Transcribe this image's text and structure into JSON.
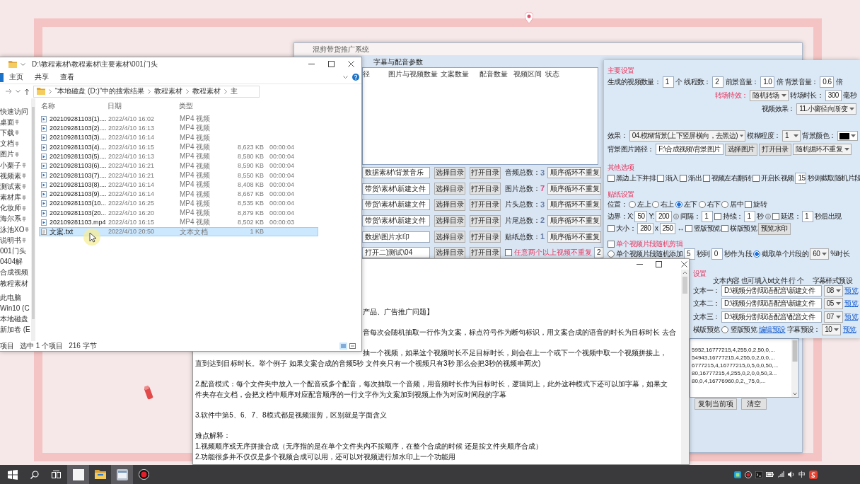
{
  "explorer": {
    "title": "D:\\教程素材\\教程素材\\主要素材\\001门头",
    "ribbon_tabs": [
      {
        "label": "主页",
        "selected": false
      },
      {
        "label": "共享",
        "selected": false
      },
      {
        "label": "查看",
        "selected": false
      }
    ],
    "breadcrumbs": [
      "“本地磁盘 (D:)”中的搜索结果",
      "教程素材",
      "教程素材",
      "主"
    ],
    "nav_groups": [
      {
        "label": "快速访问",
        "items": [
          {
            "label": "桌面",
            "pinned": true
          },
          {
            "label": "下载",
            "pinned": true
          },
          {
            "label": "文档",
            "pinned": true
          },
          {
            "label": "图片",
            "pinned": true
          },
          {
            "label": "小栗子",
            "pinned": true
          },
          {
            "label": "视频素",
            "pinned": true
          },
          {
            "label": "测试素",
            "pinned": true
          },
          {
            "label": "素材库",
            "pinned": true
          },
          {
            "label": "化妆师",
            "pinned": true
          },
          {
            "label": "海尔系",
            "pinned": true
          },
          {
            "label": "泳池XO",
            "pinned": true
          },
          {
            "label": "说明书",
            "pinned": true
          },
          {
            "label": "001门头",
            "pinned": false
          },
          {
            "label": "0404解",
            "pinned": false
          },
          {
            "label": "合成视频",
            "pinned": false
          },
          {
            "label": "教程素材",
            "pinned": false
          }
        ]
      },
      {
        "label": "此电脑",
        "items": [
          {
            "label": "Win10 (C",
            "pinned": false
          },
          {
            "label": "本地磁盘",
            "pinned": false
          },
          {
            "label": "新加卷 (E",
            "pinned": false
          }
        ]
      }
    ],
    "columns": [
      "名称",
      "日期",
      "类型"
    ],
    "files": [
      {
        "kind": "video",
        "name": "202109281103(1)....",
        "date": "2022/4/10 16:02",
        "type": "MP4 视频",
        "selected": false
      },
      {
        "kind": "video",
        "name": "202109281103(2)....",
        "date": "2022/4/10 16:13",
        "type": "MP4 视频",
        "selected": false
      },
      {
        "kind": "video",
        "name": "202109281103(3)....",
        "date": "2022/4/10 16:14",
        "type": "MP4 视频",
        "selected": false
      },
      {
        "kind": "video",
        "name": "202109281103(4)....",
        "date": "2022/4/10 16:15",
        "type": "MP4 视频",
        "size": "8,623 KB",
        "length": "00:00:04",
        "selected": false
      },
      {
        "kind": "video",
        "name": "202109281103(5)....",
        "date": "2022/4/10 16:13",
        "type": "MP4 视频",
        "size": "8,580 KB",
        "length": "00:00:04",
        "selected": false
      },
      {
        "kind": "video",
        "name": "202109281103(6)....",
        "date": "2022/4/10 16:21",
        "type": "MP4 视频",
        "size": "8,590 KB",
        "length": "00:00:04",
        "selected": false
      },
      {
        "kind": "video",
        "name": "202109281103(7)....",
        "date": "2022/4/10 16:21",
        "type": "MP4 视频",
        "size": "8,550 KB",
        "length": "00:00:04",
        "selected": false
      },
      {
        "kind": "video",
        "name": "202109281103(8)....",
        "date": "2022/4/10 16:14",
        "type": "MP4 视频",
        "size": "8,408 KB",
        "length": "00:00:04",
        "selected": false
      },
      {
        "kind": "video",
        "name": "202109281103(9)....",
        "date": "2022/4/10 16:14",
        "type": "MP4 视频",
        "size": "8,667 KB",
        "length": "00:00:04",
        "selected": false
      },
      {
        "kind": "video",
        "name": "202109281103(10...",
        "date": "2022/4/10 16:25",
        "type": "MP4 视频",
        "size": "8,535 KB",
        "length": "00:00:04",
        "selected": false
      },
      {
        "kind": "video",
        "name": "202109281103(20...",
        "date": "2022/4/10 16:20",
        "type": "MP4 视频",
        "size": "8,879 KB",
        "length": "00:00:04",
        "selected": false
      },
      {
        "kind": "video",
        "name": "202109281103.mp4",
        "date": "2022/4/10 16:15",
        "type": "MP4 视频",
        "size": "8,502 KB",
        "length": "00:00:03",
        "selected": false
      },
      {
        "kind": "text",
        "name": "文案.txt",
        "date": "2022/4/10 20:50",
        "type": "文本文档",
        "size": "1 KB",
        "selected": true
      }
    ],
    "status": {
      "items": "项目",
      "selection": "选中 1 个项目",
      "size": "216 字节"
    }
  },
  "app": {
    "title": "混剪带货推广系统",
    "tabs": [
      {
        "label": "字幕与配音参数",
        "selected": false
      }
    ],
    "list_columns": [
      "径",
      "图片与视频数量",
      "文案数量",
      "配音数量",
      "视频区间",
      "状态"
    ],
    "folders": [
      {
        "path": "数据素材\\背景音乐",
        "buttons": [
          "选择目录",
          "打开目录"
        ],
        "count_label": "音频总数：",
        "count": "3",
        "color": "#6b7fa6",
        "mode": "顺序循环不重复"
      },
      {
        "path": "带货\\素材\\新建文件",
        "buttons": [
          "选择目录",
          "打开目录"
        ],
        "count_label": "图片总数：",
        "count": "7",
        "color": "#e0457b",
        "mode": "顺序循环不重复"
      },
      {
        "path": "带货\\素材\\新建文件",
        "buttons": [
          "选择目录",
          "打开目录"
        ],
        "count_label": "片头总数：",
        "count": "3",
        "color": "#6b7fa6",
        "mode": "顺序循环不重复"
      },
      {
        "path": "带货\\素材\\新建文件",
        "buttons": [
          "选择目录",
          "打开目录"
        ],
        "count_label": "片尾总数：",
        "count": "2",
        "color": "#6b7fa6",
        "mode": "顺序循环不重复"
      },
      {
        "path": "数据\\图片水印",
        "buttons": [
          "选择目录",
          "打开目录"
        ],
        "count_label": "贴纸总数：",
        "count": "1",
        "color": "#6b7fa6",
        "mode": "顺序循环不重复"
      }
    ],
    "extra_folder": {
      "path": "打开二)测试\\04",
      "buttons": [
        "选择目录",
        "打开目录"
      ],
      "checked": false,
      "label": "任意两个以上视频不重复",
      "value": "2"
    },
    "settings": [
      {
        "title": "主要设置",
        "rows": [
          {
            "controls": [
              {
                "kind": "label",
                "text": "生成的视频数量："
              },
              {
                "kind": "input",
                "value": "1"
              },
              {
                "kind": "label",
                "text": "个"
              },
              {
                "kind": "label",
                "text": "线程数："
              },
              {
                "kind": "input",
                "value": "2"
              },
              {
                "kind": "label",
                "text": "前景音量："
              },
              {
                "kind": "input",
                "value": "1.0"
              },
              {
                "kind": "label",
                "text": "倍"
              },
              {
                "kind": "label",
                "text": "背景音量："
              },
              {
                "kind": "input",
                "value": "0.6"
              },
              {
                "kind": "label",
                "text": "倍"
              }
            ]
          },
          {
            "controls": [
              {
                "kind": "note",
                "text": "转场特效："
              },
              {
                "kind": "select",
                "value": "随机转场"
              },
              {
                "kind": "label",
                "text": "转场时长："
              },
              {
                "kind": "input",
                "value": "300"
              },
              {
                "kind": "label",
                "text": "毫秒"
              }
            ]
          },
          {
            "controls": [
              {
                "kind": "label",
                "text": "视频效果："
              },
              {
                "kind": "select",
                "value": "11.小窗径向渐变"
              }
            ]
          },
          {
            "controls": [
              {
                "kind": "label",
                "text": "效果："
              },
              {
                "kind": "select",
                "value": "04.模糊背景(上下竖屏横向，去黑边)"
              },
              {
                "kind": "label",
                "text": "模糊程度："
              },
              {
                "kind": "select",
                "value": "1"
              },
              {
                "kind": "label",
                "text": "背景颜色："
              },
              {
                "kind": "swatch",
                "color": "#000000"
              }
            ]
          },
          {
            "controls": [
              {
                "kind": "label",
                "text": "背景图片路径："
              },
              {
                "kind": "input",
                "value": "F:\\合成视频\\背景图片"
              },
              {
                "kind": "button",
                "text": "选择图片"
              },
              {
                "kind": "button",
                "text": "打开目录"
              },
              {
                "kind": "select",
                "value": "随机循环不重复"
              }
            ]
          }
        ]
      },
      {
        "title": "其他选项",
        "rows": [
          {
            "controls": [
              {
                "kind": "checkbox",
                "text": "黑边上下并排",
                "checked": false
              },
              {
                "kind": "checkbox",
                "text": "渐入",
                "checked": false
              },
              {
                "kind": "checkbox",
                "text": "渐出",
                "checked": false
              },
              {
                "kind": "checkbox",
                "text": "视频左右翻转",
                "checked": false
              },
              {
                "kind": "checkbox",
                "text": "开启长视频",
                "checked": false
              },
              {
                "kind": "input",
                "value": "15"
              },
              {
                "kind": "label",
                "text": "秒则截取随机片段"
              }
            ]
          }
        ]
      },
      {
        "title": "贴纸设置",
        "rows": [
          {
            "controls": [
              {
                "kind": "label",
                "text": "位置："
              },
              {
                "kind": "radio",
                "text": "左上",
                "selected": false
              },
              {
                "kind": "radio",
                "text": "右上",
                "selected": false
              },
              {
                "kind": "radio",
                "text": "左下",
                "selected": true
              },
              {
                "kind": "radio",
                "text": "右下",
                "selected": false
              },
              {
                "kind": "radio",
                "text": "居中",
                "selected": false
              },
              {
                "kind": "checkbox",
                "text": "旋转",
                "checked": false
              }
            ]
          },
          {
            "controls": [
              {
                "kind": "label",
                "text": "边界：X:"
              },
              {
                "kind": "input",
                "value": "50"
              },
              {
                "kind": "label",
                "text": "Y:"
              },
              {
                "kind": "input",
                "value": "200"
              },
              {
                "kind": "info"
              },
              {
                "kind": "label",
                "text": "间隔："
              },
              {
                "kind": "input",
                "value": "1"
              },
              {
                "kind": "checkbox",
                "checked": false
              },
              {
                "kind": "label",
                "text": "持续："
              },
              {
                "kind": "input",
                "value": "1"
              },
              {
                "kind": "label",
                "text": "秒"
              },
              {
                "kind": "info"
              },
              {
                "kind": "checkbox",
                "text": "延迟：",
                "checked": false
              },
              {
                "kind": "input",
                "value": "1"
              },
              {
                "kind": "label",
                "text": "秒后出现"
              }
            ]
          },
          {
            "controls": [
              {
                "kind": "checkbox",
                "text": "大小：",
                "checked": false
              },
              {
                "kind": "input",
                "value": "280"
              },
              {
                "kind": "label",
                "text": "x"
              },
              {
                "kind": "input",
                "value": "250"
              },
              {
                "kind": "label",
                "text": "↔"
              },
              {
                "kind": "checkbox",
                "text": "竖版预览",
                "checked": false
              },
              {
                "kind": "checkbox",
                "text": "横版预览",
                "checked": false
              },
              {
                "kind": "button",
                "text": "预览水印"
              }
            ]
          }
        ]
      },
      {
        "title": "单个视频片段随机剪辑",
        "checked": false,
        "rows": [
          {
            "controls": [
              {
                "kind": "radio",
                "text": "单个视频片段随机添加",
                "selected": false
              },
              {
                "kind": "input",
                "value": "5"
              },
              {
                "kind": "label",
                "text": "秒到"
              },
              {
                "kind": "input",
                "value": "0"
              },
              {
                "kind": "label",
                "text": "秒作为"
              },
              {
                "kind": "label",
                "text": "段"
              },
              {
                "kind": "radio",
                "text": "截取单个片段的",
                "selected": true
              },
              {
                "kind": "select",
                "value": "60"
              },
              {
                "kind": "label",
                "text": "%时长"
              }
            ]
          }
        ]
      },
      {
        "title": "设置",
        "rows": [
          {
            "controls": [
              {
                "kind": "label",
                "text": "文本内容 也可填入txt文件 行 个"
              },
              {
                "kind": "label",
                "text": "字幕样式预设"
              }
            ]
          },
          {
            "controls": [
              {
                "kind": "label",
                "text": "文本一："
              },
              {
                "kind": "input",
                "value": "D:\\视频分割\\双语配音\\新建文件"
              },
              {
                "kind": "select",
                "value": "08"
              },
              {
                "kind": "link",
                "text": "预览"
              }
            ]
          },
          {
            "controls": [
              {
                "kind": "label",
                "text": "文本二："
              },
              {
                "kind": "input",
                "value": "D:\\视频分割\\双语配音\\新建文件"
              },
              {
                "kind": "select",
                "value": "05"
              },
              {
                "kind": "link",
                "text": "预览"
              }
            ]
          },
          {
            "controls": [
              {
                "kind": "label",
                "text": "文本三："
              },
              {
                "kind": "input",
                "value": "D:\\视频分割\\双语配音\\配音文件"
              },
              {
                "kind": "select",
                "value": "07"
              },
              {
                "kind": "link",
                "text": "预览"
              }
            ]
          },
          {
            "controls": [
              {
                "kind": "label",
                "text": "横版预览"
              },
              {
                "kind": "radio",
                "text": "竖版预览",
                "selected": false
              },
              {
                "kind": "link",
                "text": "编辑预设"
              },
              {
                "kind": "label",
                "text": "字幕预设："
              },
              {
                "kind": "select",
                "value": "10"
              },
              {
                "kind": "link",
                "text": "预览"
              }
            ]
          }
        ]
      }
    ],
    "presets": {
      "lines": [
        "5952,16777215,4,255,0,2,50,0,...",
        "54943,16777215,4,255,0,2,0,0,...",
        "6777215,4,16777215,0,5,0,0,50,...",
        "80,16777215,4,255,0,2,0,0,50,3...",
        "80,0,4,16776960,0,2,_75,0,..."
      ],
      "buttons": [
        "复制当前项",
        "清空"
      ]
    }
  },
  "notepad": {
    "paragraphs": [
      [
        "产品、广告推广问题】"
      ],
      [
        "音每次会随机抽取一行作为文案，标点符号作为断句标识，用文案合成的语音的时长为目标时长 去合"
      ],
      [
        "抽一个视频，如果这个视频时长不足目标时长，则会在上一个或下一个视频中取一个视频拼接上，",
        "直到达到目标时长。举个例子 如果文案合成的音频5秒 文件夹只有一个视频只有3秒 那么会把3秒的视频串两次)"
      ],
      [
        "2.配音模式：每个文件夹中放入一个配音或多个配音，每次抽取一个音频，用音频时长作为目标时长，逻辑同上，此外这种模式下还可以加字幕，如果文",
        "件夹存在文档，会把文档中顺序对应配音顺序的一行文字作为文案加到视频上作为对应时间段的字幕"
      ],
      [
        "3.软件中第5、6、7、8模式都是视频混剪，区别就是字面含义"
      ],
      [
        "难点解释：",
        "1.视频顺序或无序拼接合成（无序指的是在单个文件夹内不按顺序，在整个合成的时候 还是按文件夹顺序合成）",
        "2.功能很多并不仅仅是多个视频合成可以用，还可以对视频进行加水印上一个功能用"
      ]
    ]
  },
  "taskbar": {
    "buttons": [
      {
        "kind": "start",
        "active": false
      },
      {
        "kind": "search",
        "active": false
      },
      {
        "kind": "task-view",
        "active": false
      },
      {
        "kind": "blank-app",
        "active": true
      },
      {
        "kind": "folder",
        "active": false
      },
      {
        "kind": "window-app",
        "active": true
      },
      {
        "kind": "record",
        "active": false
      }
    ],
    "tray": [
      {
        "kind": "app"
      },
      {
        "kind": "record"
      },
      {
        "kind": "terminal"
      },
      {
        "kind": "battery"
      },
      {
        "kind": "network"
      },
      {
        "kind": "volume"
      },
      {
        "kind": "ime",
        "text": "中"
      },
      {
        "kind": "logo"
      }
    ]
  }
}
